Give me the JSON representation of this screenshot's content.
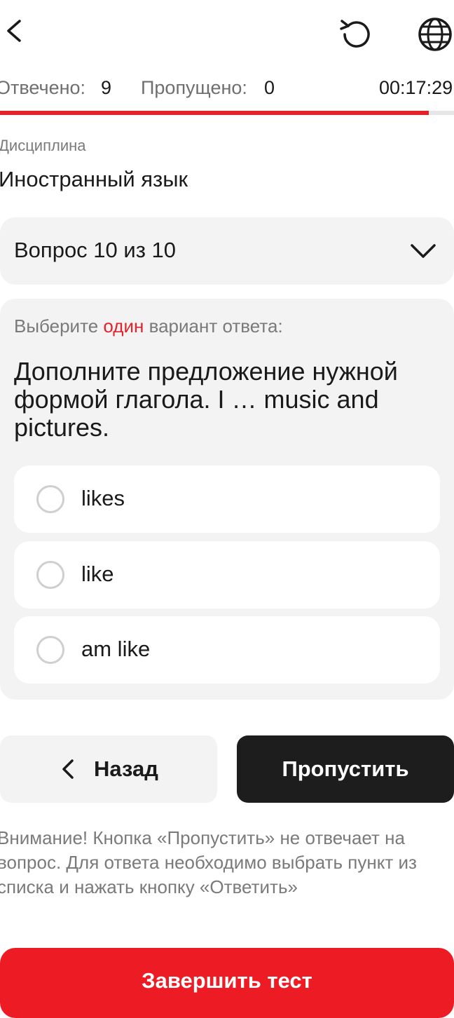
{
  "header": {
    "back_icon": "chevron-left-icon",
    "reset_icon": "rotate-ccw-icon",
    "language_icon": "globe-icon"
  },
  "stats": {
    "answered_label": "Отвечено:",
    "answered_value": "9",
    "skipped_label": "Пропущено:",
    "skipped_value": "0",
    "timer": "00:17:29"
  },
  "progress": {
    "fraction": 0.944,
    "fill_color": "#e3222b",
    "track_color": "#e6e6e6"
  },
  "discipline": {
    "label": "Дисциплина",
    "value": "Иностранный язык"
  },
  "question_selector": {
    "label": "Вопрос 10 из 10",
    "chevron_icon": "chevron-down-icon"
  },
  "question": {
    "instruction_prefix": "Выберите",
    "instruction_accent": "один",
    "instruction_suffix": "вариант ответа:",
    "text": "Дополните предложение нужной формой глагола. I … music and pictures.",
    "options": [
      {
        "label": "likes",
        "selected": false
      },
      {
        "label": "like",
        "selected": false
      },
      {
        "label": "am like",
        "selected": false
      }
    ]
  },
  "buttons": {
    "back_label": "Назад",
    "skip_label": "Пропустить",
    "finish_label": "Завершить тест"
  },
  "notice": "Внимание! Кнопка «Пропустить» не отвечает на вопрос. Для ответа необходимо выбрать пункт из списка и нажать кнопку «Ответить»",
  "colors": {
    "accent_red": "#e3222b",
    "finish_red": "#ed1c24",
    "dark_button": "#1d1d1d",
    "card_bg": "#f3f3f3"
  }
}
